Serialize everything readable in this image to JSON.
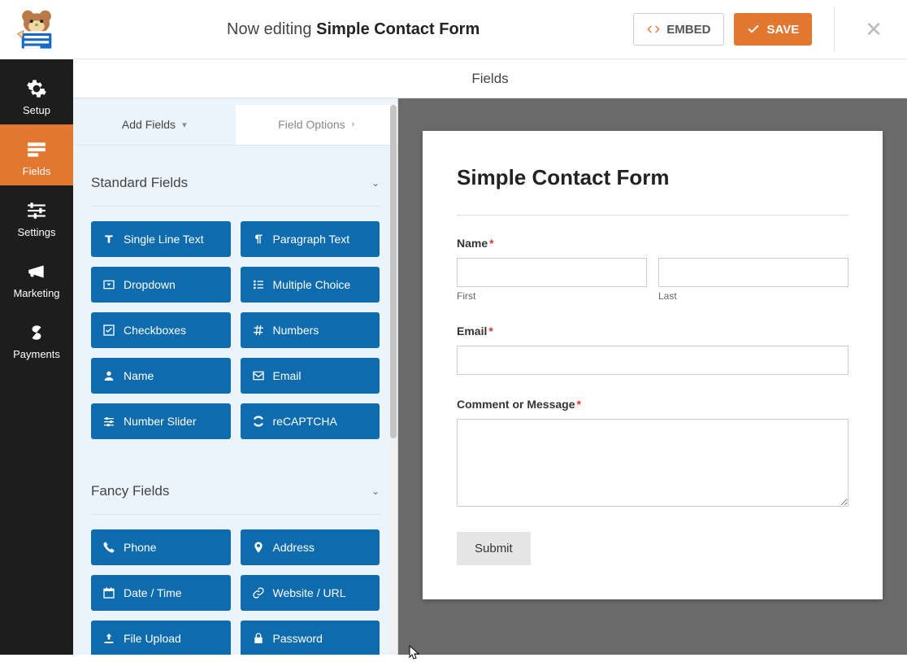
{
  "header": {
    "editing_prefix": "Now editing",
    "form_name": "Simple Contact Form",
    "embed_label": "EMBED",
    "save_label": "SAVE"
  },
  "leftnav": {
    "items": [
      {
        "key": "setup",
        "label": "Setup"
      },
      {
        "key": "fields",
        "label": "Fields"
      },
      {
        "key": "settings",
        "label": "Settings"
      },
      {
        "key": "marketing",
        "label": "Marketing"
      },
      {
        "key": "payments",
        "label": "Payments"
      }
    ]
  },
  "sub_toolbar": {
    "title": "Fields"
  },
  "palette": {
    "tabs": {
      "add_fields": "Add Fields",
      "field_options": "Field Options"
    },
    "sections": {
      "standard": {
        "title": "Standard Fields",
        "fields": [
          "Single Line Text",
          "Paragraph Text",
          "Dropdown",
          "Multiple Choice",
          "Checkboxes",
          "Numbers",
          "Name",
          "Email",
          "Number Slider",
          "reCAPTCHA"
        ]
      },
      "fancy": {
        "title": "Fancy Fields",
        "fields": [
          "Phone",
          "Address",
          "Date / Time",
          "Website / URL",
          "File Upload",
          "Password"
        ]
      }
    }
  },
  "preview": {
    "form_title": "Simple Contact Form",
    "fields": {
      "name": {
        "label": "Name",
        "required": true,
        "first_label": "First",
        "last_label": "Last"
      },
      "email": {
        "label": "Email",
        "required": true
      },
      "comment": {
        "label": "Comment or Message",
        "required": true
      }
    },
    "submit_label": "Submit"
  }
}
